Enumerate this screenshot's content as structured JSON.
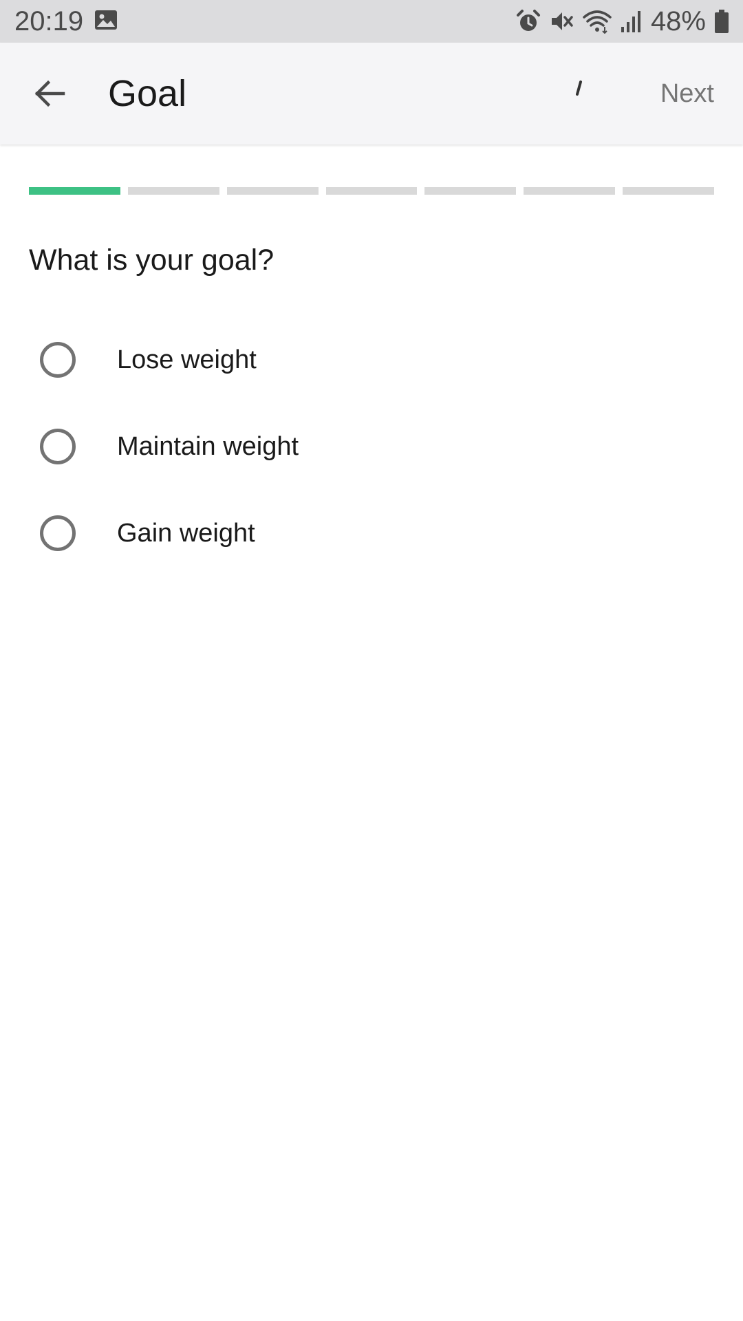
{
  "status_bar": {
    "time": "20:19",
    "battery_percent": "48%",
    "icons": [
      "gallery-icon",
      "alarm-icon",
      "mute-icon",
      "wifi-icon",
      "signal-icon",
      "battery-icon"
    ]
  },
  "app_bar": {
    "title": "Goal",
    "next_label": "Next",
    "tick": "ʼ"
  },
  "progress": {
    "total_steps": 7,
    "current_step": 1,
    "active_color": "#3dc184",
    "inactive_color": "#d9d9d9"
  },
  "question": "What is your goal?",
  "options": [
    {
      "label": "Lose weight",
      "selected": false
    },
    {
      "label": "Maintain weight",
      "selected": false
    },
    {
      "label": "Gain weight",
      "selected": false
    }
  ]
}
